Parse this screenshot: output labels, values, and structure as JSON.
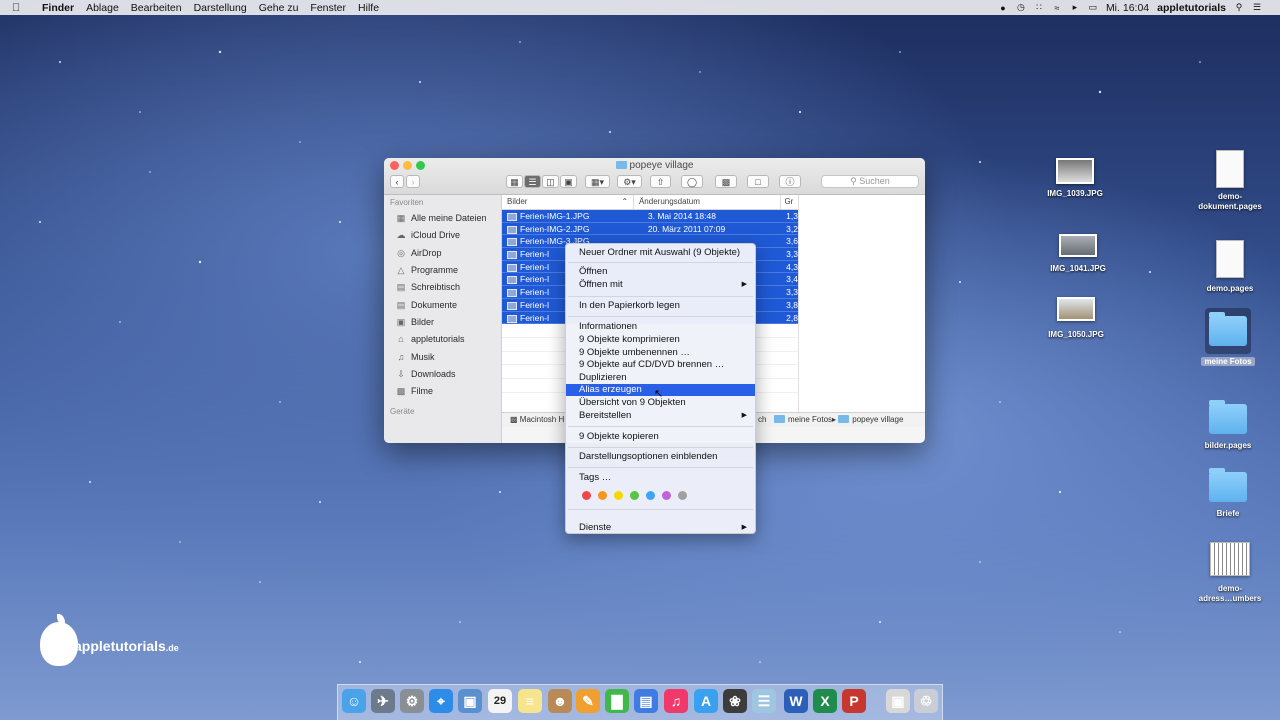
{
  "menubar": {
    "app": "Finder",
    "items": [
      "Ablage",
      "Bearbeiten",
      "Darstellung",
      "Gehe zu",
      "Fenster",
      "Hilfe"
    ],
    "clock": "Mi. 16:04",
    "user": "appletutorials"
  },
  "finder": {
    "title": "popeye village",
    "search_placeholder": "Suchen",
    "sidebar": {
      "favorites_header": "Favoriten",
      "items": [
        {
          "label": "Alle meine Dateien",
          "icon": "all-files-icon"
        },
        {
          "label": "iCloud Drive",
          "icon": "cloud-icon"
        },
        {
          "label": "AirDrop",
          "icon": "airdrop-icon"
        },
        {
          "label": "Programme",
          "icon": "applications-icon"
        },
        {
          "label": "Schreibtisch",
          "icon": "desktop-icon"
        },
        {
          "label": "Dokumente",
          "icon": "documents-icon"
        },
        {
          "label": "Bilder",
          "icon": "pictures-icon"
        },
        {
          "label": "appletutorials",
          "icon": "home-icon"
        },
        {
          "label": "Musik",
          "icon": "music-icon"
        },
        {
          "label": "Downloads",
          "icon": "downloads-icon"
        },
        {
          "label": "Filme",
          "icon": "movies-icon"
        }
      ],
      "devices_header": "Geräte"
    },
    "columns": {
      "name": "Bilder",
      "date": "Änderungsdatum",
      "size": "Gr"
    },
    "rows": [
      {
        "name": "Ferien-IMG-1.JPG",
        "date": "3. Mai 2014 18:48",
        "size": "1,3"
      },
      {
        "name": "Ferien-IMG-2.JPG",
        "date": "20. März 2011 07:09",
        "size": "3,2"
      },
      {
        "name": "Ferien-IMG-3.JPG",
        "date": "",
        "size": "3,6"
      },
      {
        "name": "Ferien-I",
        "date": "",
        "size": "3,3"
      },
      {
        "name": "Ferien-I",
        "date": "",
        "size": "4,3"
      },
      {
        "name": "Ferien-I",
        "date": "",
        "size": "3,4"
      },
      {
        "name": "Ferien-I",
        "date": "",
        "size": "3,3"
      },
      {
        "name": "Ferien-I",
        "date": "",
        "size": "3,8"
      },
      {
        "name": "Ferien-I",
        "date": "",
        "size": "2,8"
      }
    ],
    "path": [
      "Macintosh H",
      "ch",
      "meine Fotos",
      "popeye village"
    ]
  },
  "context_menu": {
    "items": [
      {
        "label": "Neuer Ordner mit Auswahl (9 Objekte)",
        "submenu": false
      },
      {
        "label": "Öffnen",
        "submenu": false
      },
      {
        "label": "Öffnen mit",
        "submenu": true
      },
      {
        "label": "In den Papierkorb legen",
        "submenu": false
      },
      {
        "label": "Informationen",
        "submenu": false
      },
      {
        "label": "9 Objekte komprimieren",
        "submenu": false
      },
      {
        "label": "9 Objekte umbenennen …",
        "submenu": false
      },
      {
        "label": "9 Objekte auf CD/DVD brennen …",
        "submenu": false
      },
      {
        "label": "Duplizieren",
        "submenu": false
      },
      {
        "label": "Alias erzeugen",
        "submenu": false,
        "highlighted": true
      },
      {
        "label": "Übersicht von 9 Objekten",
        "submenu": false
      },
      {
        "label": "Bereitstellen",
        "submenu": true
      },
      {
        "label": "9 Objekte kopieren",
        "submenu": false
      },
      {
        "label": "Darstellungsoptionen einblenden",
        "submenu": false
      },
      {
        "label": "Tags …",
        "submenu": false
      },
      {
        "label": "Dienste",
        "submenu": true
      }
    ],
    "tag_colors": [
      "#f0474a",
      "#f7931e",
      "#f5d800",
      "#5ac443",
      "#3fa4f5",
      "#bf63d8",
      "#a0a0a0"
    ],
    "highlight_color": "#2a5fe8"
  },
  "desktop": {
    "icons": [
      {
        "label": "IMG_1039.JPG"
      },
      {
        "label": "demo-dokument.pages"
      },
      {
        "label": "IMG_1041.JPG"
      },
      {
        "label": "demo.pages"
      },
      {
        "label": "IMG_1050.JPG"
      },
      {
        "label": "meine Fotos"
      },
      {
        "label": "bilder.pages"
      },
      {
        "label": "Briefe"
      },
      {
        "label": "demo-adress…umbers"
      }
    ]
  },
  "watermark": {
    "text": "appletutorials",
    "suffix": ".de"
  },
  "dock": {
    "items": [
      "finder-icon",
      "launchpad-icon",
      "system-preferences-icon",
      "safari-icon",
      "preview-icon",
      "calendar-icon",
      "notes-icon",
      "contacts-icon",
      "pages-icon",
      "numbers-icon",
      "keynote-icon",
      "itunes-icon",
      "app-store-icon",
      "photos-icon",
      "script-icon",
      "word-icon",
      "excel-icon",
      "powerpoint-icon",
      "downloads-stack-icon",
      "trash-icon"
    ],
    "calendar_day": "29"
  }
}
